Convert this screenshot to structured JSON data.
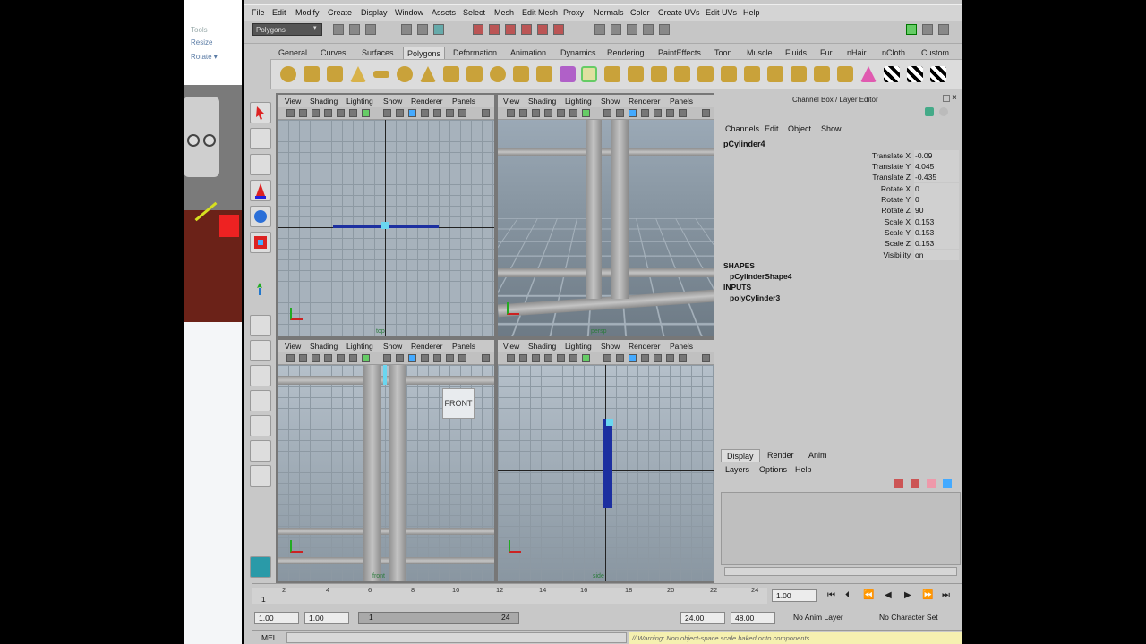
{
  "left_panel": {
    "resize_label": "Resize",
    "rotate_label": "Rotate ▾",
    "tools_label": "Tools"
  },
  "menubar": [
    "File",
    "Edit",
    "Modify",
    "Create",
    "Display",
    "Window",
    "Assets",
    "Select",
    "Mesh",
    "Edit Mesh",
    "Proxy",
    "Normals",
    "Color",
    "Create UVs",
    "Edit UVs",
    "Help"
  ],
  "status_line": {
    "mode": "Polygons"
  },
  "shelf_tabs": [
    "General",
    "Curves",
    "Surfaces",
    "Polygons",
    "Deformation",
    "Animation",
    "Dynamics",
    "Rendering",
    "PaintEffects",
    "Toon",
    "Muscle",
    "Fluids",
    "Fur",
    "nHair",
    "nCloth",
    "Custom"
  ],
  "active_shelf_tab": "Polygons",
  "panel_menu": [
    "View",
    "Shading",
    "Lighting",
    "Show",
    "Renderer",
    "Panels"
  ],
  "viewports": {
    "top_label": "top",
    "persp_label": "persp",
    "front_label": "front",
    "side_label": "side",
    "front_cube_label": "FRONT"
  },
  "channel_box": {
    "title": "Channel Box / Layer Editor",
    "menus": [
      "Channels",
      "Edit",
      "Object",
      "Show"
    ],
    "object": "pCylinder4",
    "attributes": [
      {
        "name": "Translate X",
        "value": "-0.09"
      },
      {
        "name": "Translate Y",
        "value": "4.045"
      },
      {
        "name": "Translate Z",
        "value": "-0.435"
      },
      {
        "name": "Rotate X",
        "value": "0"
      },
      {
        "name": "Rotate Y",
        "value": "0"
      },
      {
        "name": "Rotate Z",
        "value": "90"
      },
      {
        "name": "Scale X",
        "value": "0.153"
      },
      {
        "name": "Scale Y",
        "value": "0.153"
      },
      {
        "name": "Scale Z",
        "value": "0.153"
      },
      {
        "name": "Visibility",
        "value": "on"
      }
    ],
    "shapes_label": "SHAPES",
    "shape_node": "pCylinderShape4",
    "inputs_label": "INPUTS",
    "input_node": "polyCylinder3"
  },
  "layer_editor": {
    "tabs": [
      "Display",
      "Render",
      "Anim"
    ],
    "active_tab": "Display",
    "menus": [
      "Layers",
      "Options",
      "Help"
    ]
  },
  "time_slider": {
    "ticks": [
      "1",
      "2",
      "4",
      "6",
      "8",
      "10",
      "12",
      "14",
      "16",
      "18",
      "20",
      "22",
      "24"
    ],
    "current_frame": "1.00"
  },
  "range_slider": {
    "start": "1.00",
    "playback_start": "1.00",
    "range_start": "1",
    "range_end": "24",
    "playback_end": "24.00",
    "end": "48.00",
    "anim_layer": "No Anim Layer",
    "character_set": "No Character Set"
  },
  "command_line": {
    "label": "MEL",
    "result": "// Warning: Non object-space scale baked onto components."
  }
}
